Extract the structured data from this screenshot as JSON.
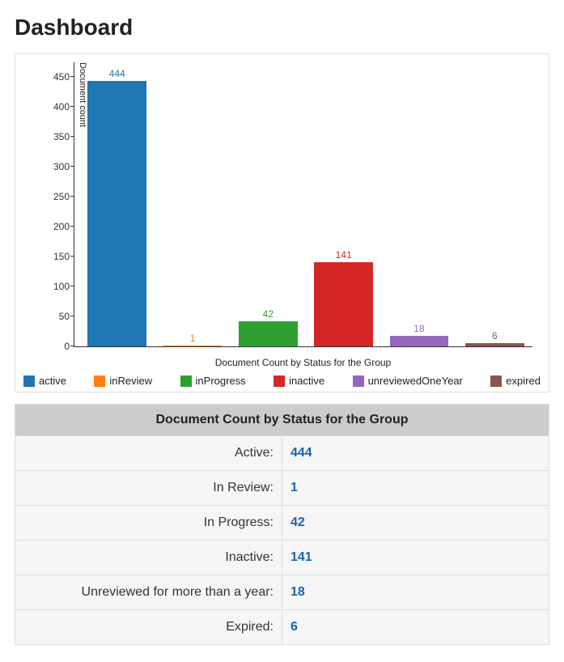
{
  "title": "Dashboard",
  "chart_data": {
    "type": "bar",
    "categories": [
      "active",
      "inReview",
      "inProgress",
      "inactive",
      "unreviewedOneYear",
      "expired"
    ],
    "values": [
      444,
      1,
      42,
      141,
      18,
      6
    ],
    "colors": [
      "#1f77b4",
      "#ff7f0e",
      "#2ca02c",
      "#d62728",
      "#9467bd",
      "#8c564b"
    ],
    "title": "",
    "xlabel": "Document Count by Status for the Group",
    "ylabel": "Document count",
    "ylim": [
      0,
      475
    ],
    "yticks": [
      0,
      50,
      100,
      150,
      200,
      250,
      300,
      350,
      400,
      450
    ]
  },
  "legend": [
    {
      "label": "active",
      "color": "#1f77b4"
    },
    {
      "label": "inReview",
      "color": "#ff7f0e"
    },
    {
      "label": "inProgress",
      "color": "#2ca02c"
    },
    {
      "label": "inactive",
      "color": "#d62728"
    },
    {
      "label": "unreviewedOneYear",
      "color": "#9467bd"
    },
    {
      "label": "expired",
      "color": "#8c564b"
    }
  ],
  "table": {
    "header": "Document Count by Status for the Group",
    "rows": [
      {
        "label": "Active:",
        "value": "444"
      },
      {
        "label": "In Review:",
        "value": "1"
      },
      {
        "label": "In Progress:",
        "value": "42"
      },
      {
        "label": "Inactive:",
        "value": "141"
      },
      {
        "label": "Unreviewed for more than a year:",
        "value": "18"
      },
      {
        "label": "Expired:",
        "value": "6"
      }
    ]
  }
}
